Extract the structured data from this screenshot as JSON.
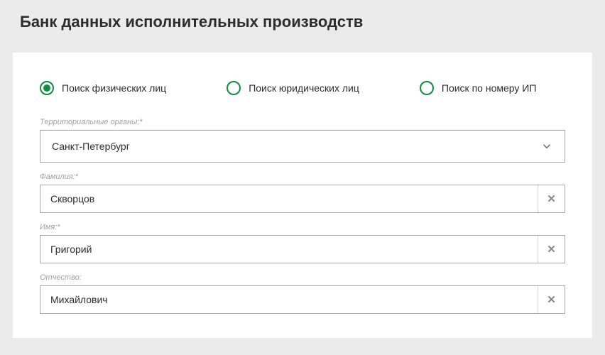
{
  "title": "Банк данных исполнительных производств",
  "search_types": {
    "individuals": "Поиск физических лиц",
    "legal": "Поиск юридических лиц",
    "by_number": "Поиск по номеру ИП"
  },
  "form": {
    "territory": {
      "label": "Территориальные органы:*",
      "value": "Санкт-Петербург"
    },
    "lastname": {
      "label": "Фамилия:*",
      "value": "Скворцов"
    },
    "firstname": {
      "label": "Имя:*",
      "value": "Григорий"
    },
    "patronymic": {
      "label": "Отчество:",
      "value": "Михайлович"
    }
  }
}
